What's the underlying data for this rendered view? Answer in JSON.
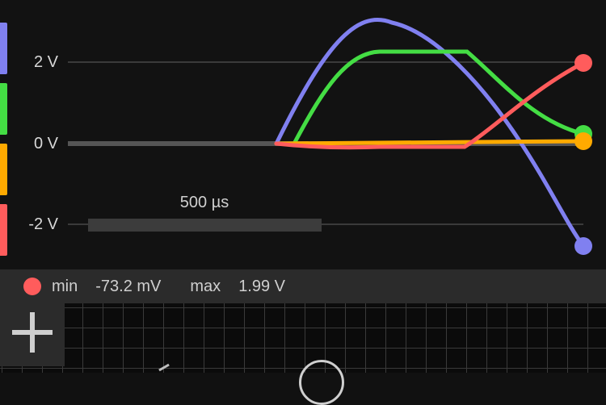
{
  "channels": [
    {
      "name": "blue",
      "color": "#8080f0"
    },
    {
      "name": "green",
      "color": "#44dd44"
    },
    {
      "name": "orange",
      "color": "#ffaa00"
    },
    {
      "name": "red",
      "color": "#ff5c5c"
    }
  ],
  "axis": {
    "labels": [
      "2 V",
      "0 V",
      "-2 V"
    ],
    "values": [
      2,
      0,
      -2
    ]
  },
  "timebase": {
    "label": "500 µs"
  },
  "status": {
    "dot_color": "#ff5c5c",
    "min_label": "min",
    "min_value": "-73.2 mV",
    "max_label": "max",
    "max_value": "1.99 V"
  },
  "traces": [
    {
      "name": "blue",
      "color": "#8080f0",
      "end_value": -2.3
    },
    {
      "name": "green",
      "color": "#44dd44",
      "end_value": 0.2
    },
    {
      "name": "orange",
      "color": "#ffaa00",
      "end_value": 0.0
    },
    {
      "name": "red",
      "color": "#ff5c5c",
      "end_value": 1.99
    }
  ],
  "toolbar": {
    "add_icon": "plus-icon"
  }
}
